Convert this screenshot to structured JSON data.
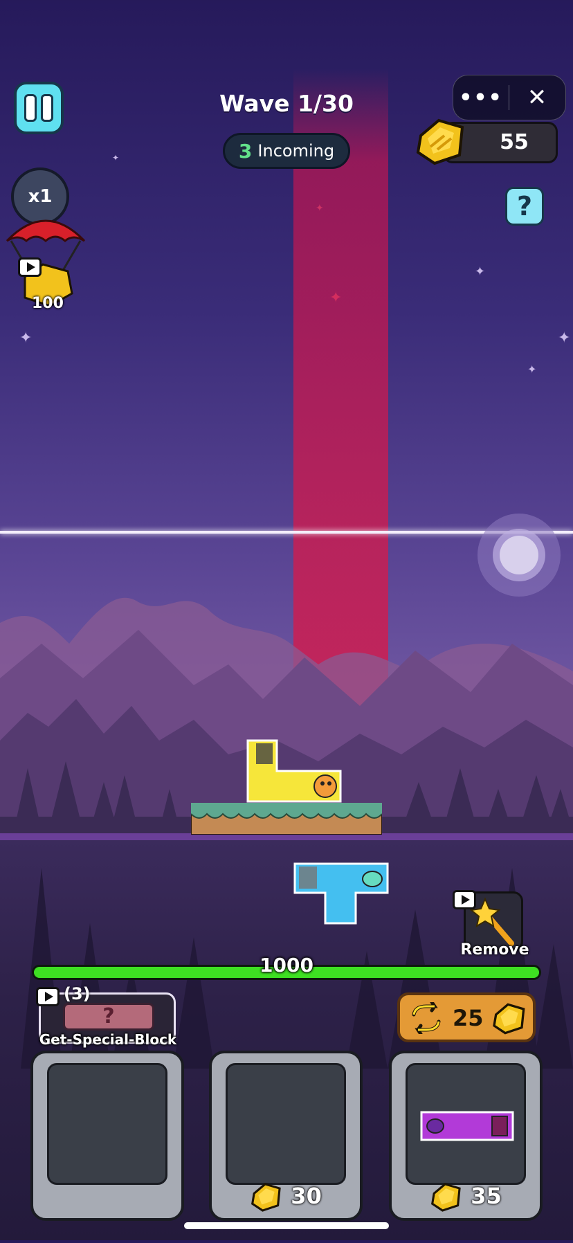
{
  "hud": {
    "wave_label": "Wave 1/30",
    "incoming_count": "3",
    "incoming_label": "Incoming",
    "gold_amount": "55",
    "speed_label": "x1",
    "help_label": "?",
    "menu_dots": "•••",
    "menu_close": "✕"
  },
  "airdrop": {
    "reward": "100",
    "icon": "parachute-gold-icon"
  },
  "board": {
    "base_hp": "1000",
    "base_hp_fraction": 1.0,
    "remove_label": "Remove"
  },
  "special_block": {
    "count": "(3)",
    "label": "Get-Special-Block",
    "placeholder": "?"
  },
  "refresh": {
    "cost": "25"
  },
  "shop_slots": [
    {
      "price": "",
      "contents": "empty"
    },
    {
      "price": "30",
      "contents": "empty"
    },
    {
      "price": "35",
      "contents": "purple-block"
    }
  ],
  "colors": {
    "gold": "#f2c21c",
    "laser": "#d6194b",
    "hp_green": "#3ee022",
    "pause_cyan": "#5fe0f0"
  }
}
